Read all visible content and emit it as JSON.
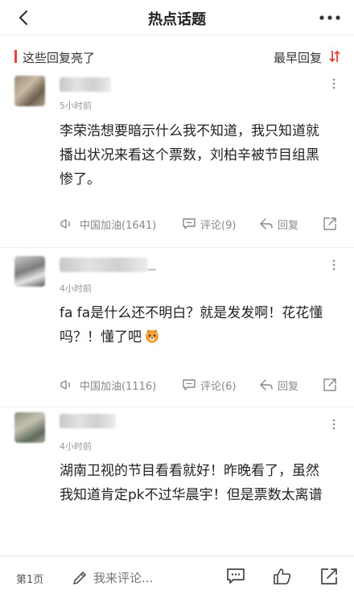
{
  "header": {
    "title": "热点话题",
    "back_icon": "chevron-left-icon",
    "more_icon": "more-horizontal-icon"
  },
  "section": {
    "label": "这些回复亮了",
    "sort_label": "最早回复",
    "accent_color": "#e8413c"
  },
  "comments": [
    {
      "time": "5小时前",
      "text": "李荣浩想要暗示什么我不知道，我只知道就播出状况来看这个票数，刘柏辛被节目组黑惨了。",
      "cheer": "中国加油(1641)",
      "comments": "评论(9)",
      "reply": "回复"
    },
    {
      "time": "4小时前",
      "text": "fa fa是什么还不明白？就是发发啊！花花懂吗？！懂了吧",
      "cheer": "中国加油(1116)",
      "comments": "评论(6)",
      "reply": "回复"
    },
    {
      "time": "4小时前",
      "text": "湖南卫视的节目看看就好！昨晚看了，虽然我知道肯定pk不过华晨宇！但是票数太离谱"
    }
  ],
  "footer": {
    "page": "第1页",
    "placeholder": "我来评论..."
  }
}
